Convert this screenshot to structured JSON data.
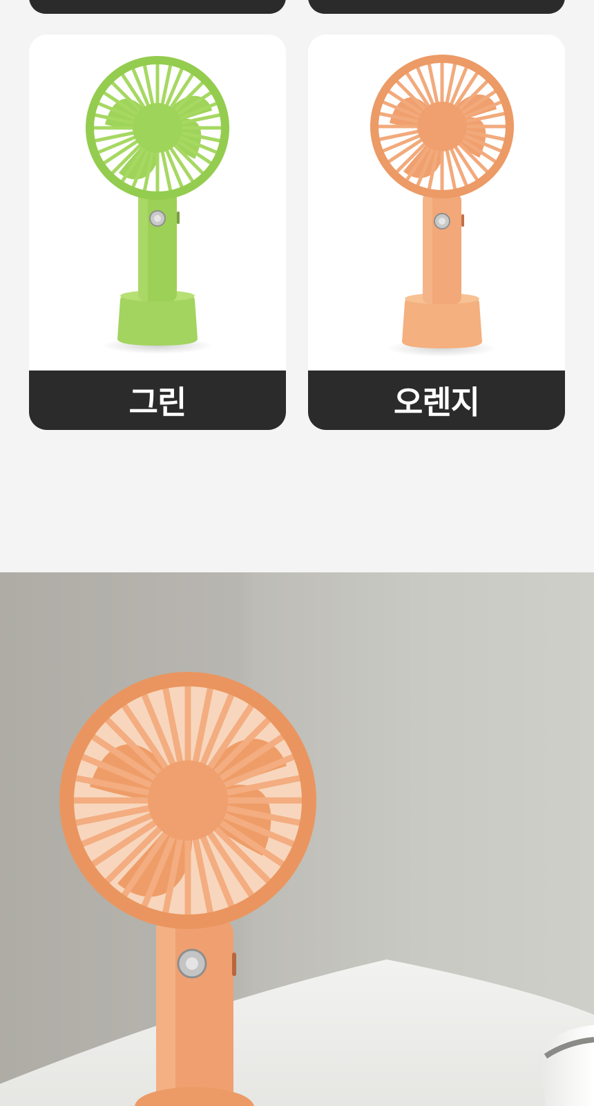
{
  "colors": {
    "page_bg": "#f4f4f4",
    "label_bg": "#2b2b2b",
    "label_text": "#ffffff",
    "green": "#9fd45a",
    "orange": "#f0a06e"
  },
  "color_options": [
    {
      "label": "그린",
      "icon": "handheld-fan-icon",
      "accent": "#9fd45a"
    },
    {
      "label": "오렌지",
      "icon": "handheld-fan-icon",
      "accent": "#f0a06e"
    }
  ],
  "hero": {
    "icon": "handheld-fan-icon",
    "accent": "#f0a06e"
  }
}
